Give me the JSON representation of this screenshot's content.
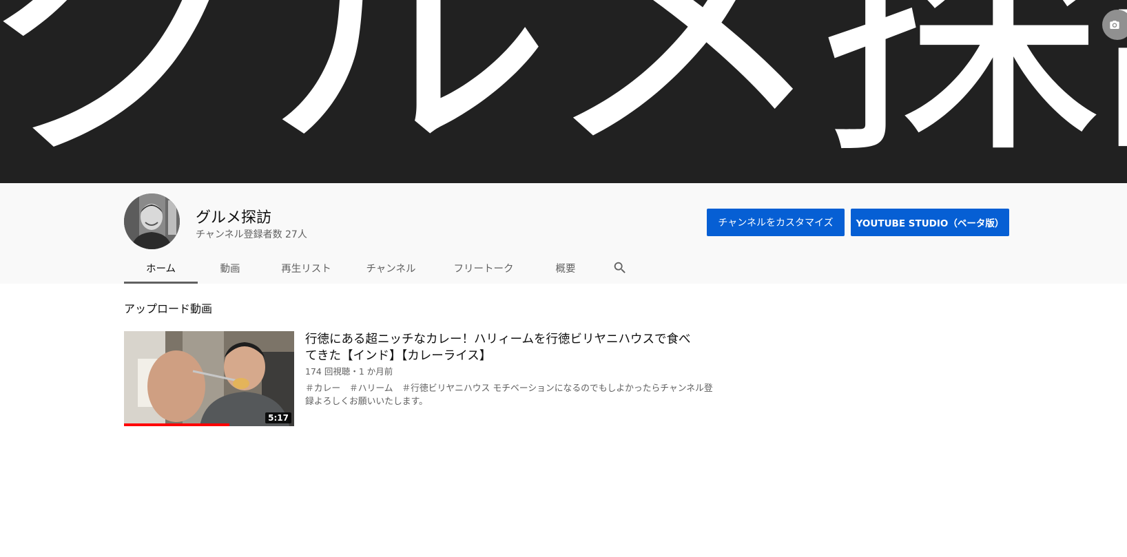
{
  "banner": {
    "text": "グルメ探訪"
  },
  "channel": {
    "name": "グルメ探訪",
    "subscribers": "チャンネル登録者数 27人"
  },
  "buttons": {
    "customize": "チャンネルをカスタマイズ",
    "studio": "YOUTUBE STUDIO（ベータ版）"
  },
  "tabs": [
    {
      "label": "ホーム",
      "active": true
    },
    {
      "label": "動画"
    },
    {
      "label": "再生リスト"
    },
    {
      "label": "チャンネル"
    },
    {
      "label": "フリートーク"
    },
    {
      "label": "概要"
    }
  ],
  "icons": {
    "search": "search-icon",
    "camera": "camera-icon"
  },
  "section": {
    "title": "アップロード動画"
  },
  "video": {
    "title": "行徳にある超ニッチなカレー！ハリィームを行徳ビリヤニハウスで食べてきた【インド】【カレーライス】",
    "meta": "174 回視聴・1 か月前",
    "description": "＃カレー　＃ハリーム　＃行徳ビリヤニハウス モチベーションになるのでもしよかったらチャンネル登録よろしくお願いいたします。",
    "duration": "5:17",
    "watch_progress": 0.62
  },
  "colors": {
    "accent": "#065fd4",
    "banner": "#212121",
    "progress": "#ff0000"
  }
}
